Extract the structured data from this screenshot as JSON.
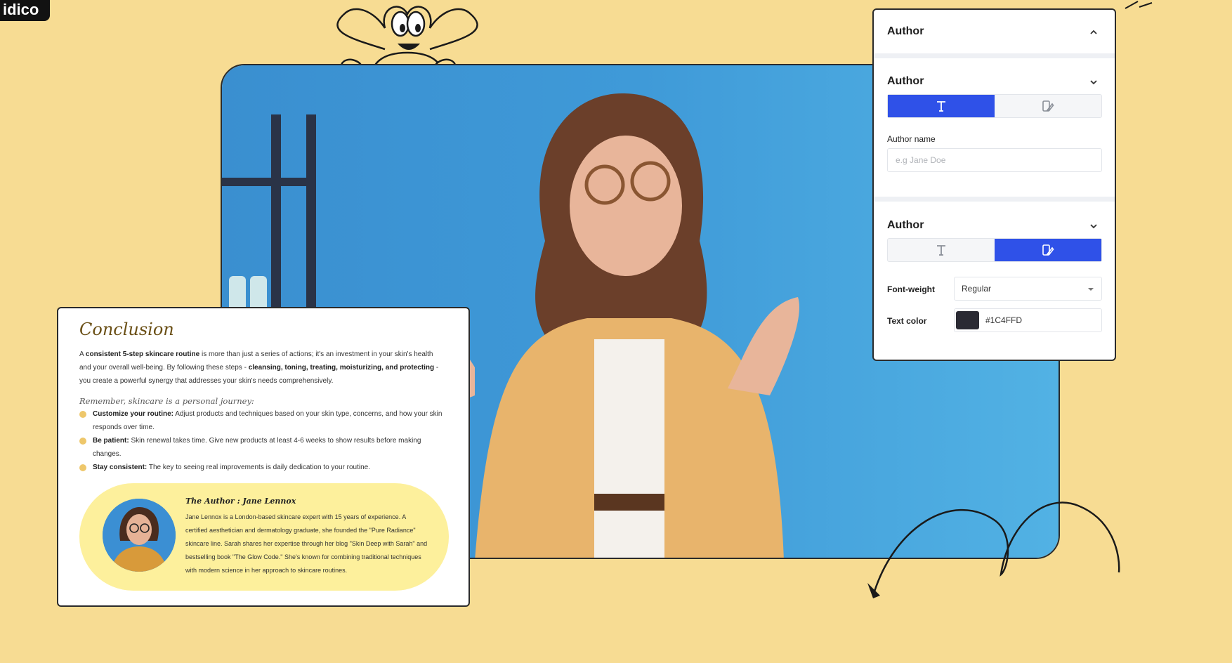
{
  "brand": {
    "logo_text": "idico"
  },
  "article": {
    "title": "Conclusion",
    "intro": {
      "t1": "A ",
      "b1": "consistent 5-step skincare routine",
      "t2": " is more than just a series of actions; it's an investment in your skin's health and your overall well-being. By following these steps - ",
      "b2": "cleansing, toning, treating, moisturizing, and protecting",
      "t3": " - you create a powerful synergy that addresses your skin's needs comprehensively."
    },
    "subheading": "Remember, skincare is a personal journey:",
    "bullets": [
      {
        "bold": "Customize your routine:",
        "text": " Adjust products and techniques based on your skin type, concerns, and how your skin responds over time."
      },
      {
        "bold": "Be patient:",
        "text": " Skin renewal takes time. Give new products at least 4-6 weeks to show results before making changes."
      },
      {
        "bold": "Stay consistent:",
        "text": " The key to seeing real improvements is daily dedication to your routine."
      }
    ],
    "author_card": {
      "title": "The Author : Jane Lennox",
      "bio": "Jane Lennox is a London-based skincare expert with 15 years of experience. A certified aesthetician and dermatology graduate, she founded the \"Pure Radiance\" skincare line. Sarah shares her expertise through her blog \"Skin Deep with Sarah\" and bestselling book \"The Glow Code.\" She's known for combining traditional techniques with modern science in her approach to skincare routines."
    }
  },
  "panel": {
    "header": "Author",
    "content_section": {
      "title": "Author",
      "active_tab": "text",
      "field_label": "Author name",
      "field_placeholder": "e.g Jane Doe",
      "field_value": ""
    },
    "style_section": {
      "title": "Author",
      "active_tab": "style",
      "font_weight_label": "Font-weight",
      "font_weight_value": "Regular",
      "text_color_label": "Text color",
      "text_color_value": "#1C4FFD"
    }
  },
  "colors": {
    "background": "#f7dc93",
    "video_bg": "#3f9ad8",
    "accent": "#2f51e8",
    "author_box": "#fdf09c",
    "bullet": "#eec76b",
    "text_color_swatch": "#2a2a33"
  },
  "icons": [
    "text-format-icon",
    "style-format-icon",
    "chevron-up-icon",
    "chevron-down-icon",
    "dropdown-caret-icon"
  ]
}
